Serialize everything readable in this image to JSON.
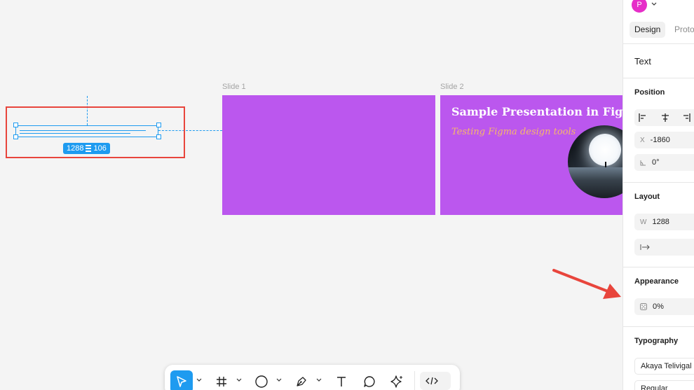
{
  "canvas": {
    "frames": [
      {
        "label": "Slide 1"
      },
      {
        "label": "Slide 2",
        "title": "Sample Presentation in Figma",
        "subtitle": "Testing Figma design tools"
      }
    ],
    "selection": {
      "width": "1288",
      "height": "106"
    }
  },
  "toolbar": {
    "tools": [
      {
        "name": "move-tool",
        "icon": "cursor-icon"
      },
      {
        "name": "frame-tool",
        "icon": "hash-icon"
      },
      {
        "name": "shape-tool",
        "icon": "ellipse-icon"
      },
      {
        "name": "pen-tool",
        "icon": "pen-icon"
      },
      {
        "name": "text-tool",
        "icon": "text-icon"
      },
      {
        "name": "comment-tool",
        "icon": "speech-bubble-icon"
      },
      {
        "name": "actions-tool",
        "icon": "sparkle-icon"
      }
    ],
    "dev_mode_icon": "code-icon"
  },
  "panel": {
    "avatar_initial": "P",
    "tabs": [
      "Design",
      "Proto"
    ],
    "layer_type": "Text",
    "position": {
      "heading": "Position",
      "x_label": "X",
      "x_value": "-1860",
      "rotation": "0°"
    },
    "layout": {
      "heading": "Layout",
      "w_label": "W",
      "w_value": "1288"
    },
    "appearance": {
      "heading": "Appearance",
      "opacity": "0%"
    },
    "typography": {
      "heading": "Typography",
      "font": "Akaya Telivigal",
      "weight": "Regular"
    }
  },
  "colors": {
    "accent": "#1e9bf0",
    "slide_bg": "#bb57ee",
    "annotation": "#e8453c"
  }
}
